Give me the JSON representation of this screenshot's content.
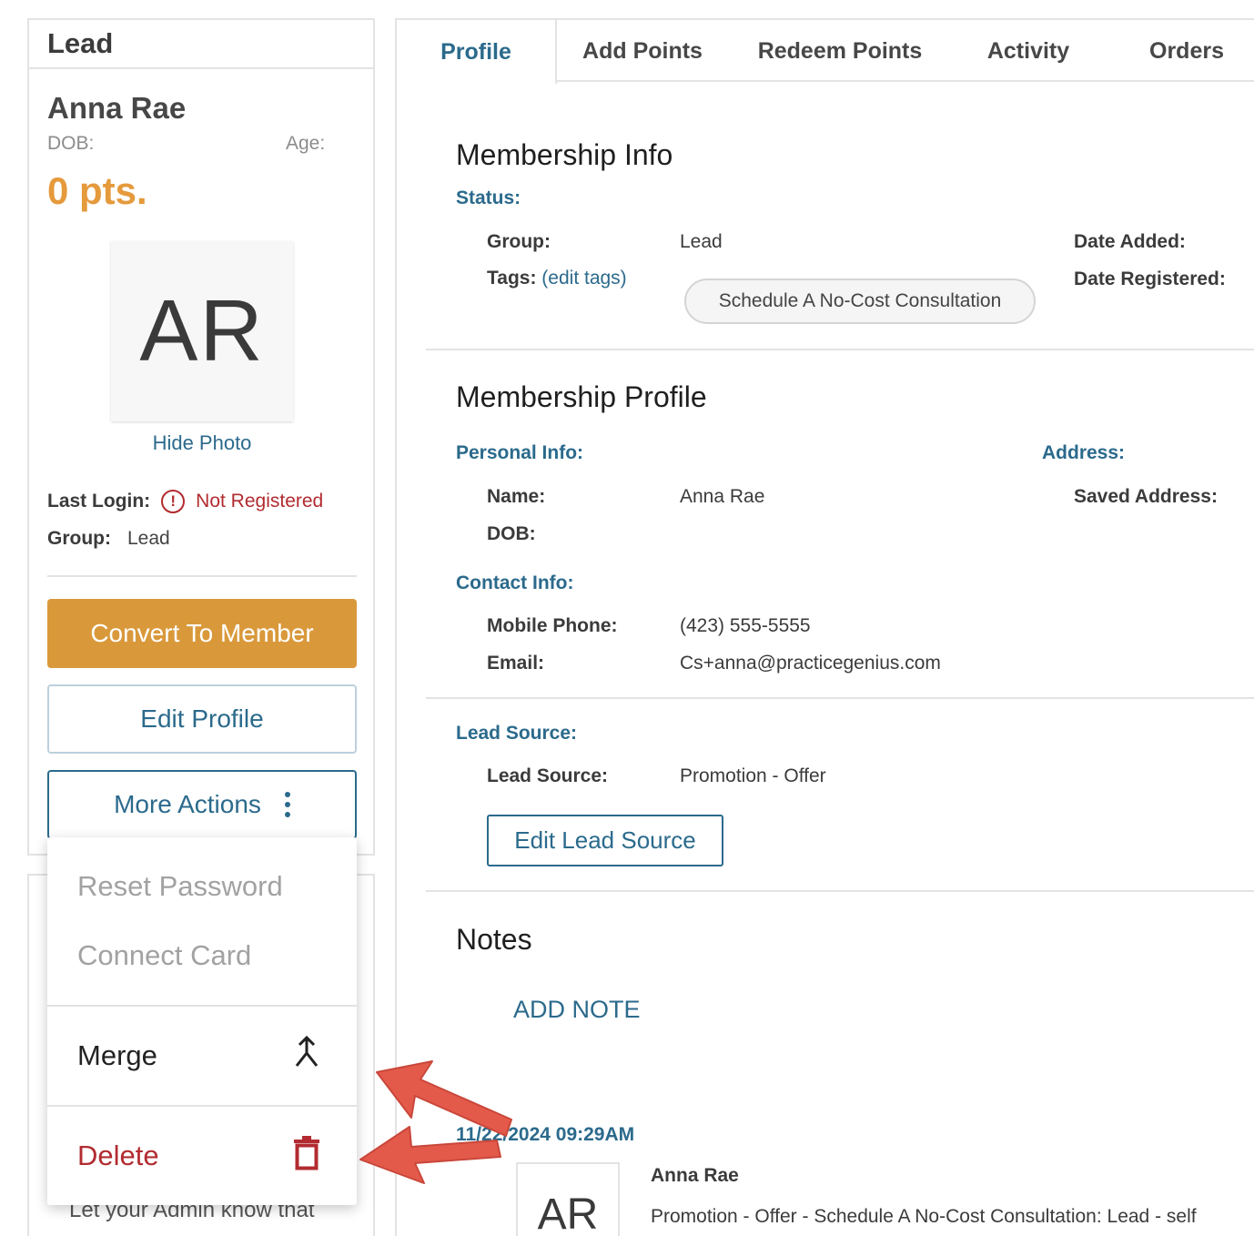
{
  "left": {
    "card_title": "Lead",
    "name": "Anna Rae",
    "dob_label": "DOB:",
    "age_label": "Age:",
    "points": "0 pts.",
    "avatar_initials": "AR",
    "hide_photo": "Hide Photo",
    "last_login_label": "Last Login:",
    "last_login_value": "Not Registered",
    "group_label": "Group:",
    "group_value": "Lead",
    "convert_button": "Convert To Member",
    "edit_button": "Edit Profile",
    "more_button": "More Actions",
    "hidden_text": "Let your Admin know that"
  },
  "dropdown": {
    "reset_password": "Reset Password",
    "connect_card": "Connect Card",
    "merge": "Merge",
    "delete": "Delete"
  },
  "tabs": [
    "Profile",
    "Add Points",
    "Redeem Points",
    "Activity",
    "Orders"
  ],
  "membership_info": {
    "title": "Membership Info",
    "status_label": "Status:",
    "group_label": "Group:",
    "group_value": "Lead",
    "tags_label": "Tags:",
    "edit_tags": "(edit tags)",
    "tag": "Schedule A No-Cost Consultation",
    "date_added_label": "Date Added:",
    "date_registered_label": "Date Registered:"
  },
  "membership_profile": {
    "title": "Membership Profile",
    "personal_info": "Personal Info:",
    "address": "Address:",
    "name_label": "Name:",
    "name_value": "Anna Rae",
    "saved_address_label": "Saved Address:",
    "dob_label": "DOB:",
    "contact_info": "Contact Info:",
    "mobile_label": "Mobile Phone:",
    "mobile_value": "(423) 555-5555",
    "email_label": "Email:",
    "email_value": "Cs+anna@practicegenius.com"
  },
  "lead_source": {
    "heading": "Lead Source:",
    "label": "Lead Source:",
    "value": "Promotion - Offer",
    "edit_button": "Edit Lead Source"
  },
  "notes": {
    "title": "Notes",
    "add_note": "ADD NOTE",
    "date": "11/22/2024 09:29AM",
    "avatar_initials": "AR",
    "author": "Anna Rae",
    "text": "Promotion - Offer - Schedule A No-Cost Consultation: Lead - self"
  },
  "colors": {
    "accent_blue": "#2b6a8c",
    "orange": "#d9993b",
    "points_orange": "#e59a3c",
    "danger_red": "#b22b30",
    "arrow_red": "#e35a4b"
  }
}
